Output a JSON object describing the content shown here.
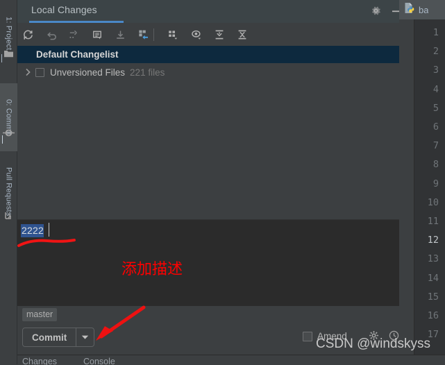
{
  "left_strip": {
    "tabs": [
      {
        "label": "1: Project",
        "icon": "project-folder-icon",
        "active": false
      },
      {
        "label": "0: Commit",
        "icon": "commit-node-icon",
        "active": true
      },
      {
        "label": "Pull Requests",
        "icon": "pull-request-icon",
        "active": false
      }
    ]
  },
  "tool_window": {
    "tab_label": "Local Changes",
    "gear_icon": "gear-icon",
    "minimize_icon": "minimize-icon",
    "accent_color": "#4a88c7"
  },
  "toolbar": {
    "buttons": [
      {
        "name": "refresh-icon",
        "title": "Refresh"
      },
      {
        "name": "rollback-icon",
        "title": "Rollback"
      },
      {
        "name": "show-diff-icon",
        "title": "Show Diff"
      },
      {
        "name": "edit-commit-message-icon",
        "title": "Edit Commit Message"
      },
      {
        "name": "update-download-icon",
        "title": "Update Project"
      },
      {
        "name": "shelve-changes-icon",
        "title": "Shelve Silently"
      },
      {
        "name": "group-by-icon",
        "title": "Group By"
      },
      {
        "name": "preview-diff-icon",
        "title": "Preview Diff"
      },
      {
        "name": "expand-all-icon",
        "title": "Expand All"
      },
      {
        "name": "collapse-all-icon",
        "title": "Collapse All"
      }
    ]
  },
  "changes_tree": {
    "changelist": {
      "label": "Default Changelist",
      "selected": true
    },
    "unversioned": {
      "expand_icon": "chevron-right-icon",
      "checkbox_checked": false,
      "label": "Unversioned Files",
      "count": "221 files"
    }
  },
  "commit_message": {
    "value": "2222",
    "selected": true
  },
  "bottom_bar": {
    "branch": "master",
    "commit_label": "Commit",
    "commit_dropdown_icon": "chevron-down-icon",
    "amend_label": "Amend",
    "amend_checked": false,
    "gear_icon": "gear-icon",
    "history_icon": "history-clock-icon"
  },
  "bottom_tabs": [
    {
      "label": "Changes"
    },
    {
      "label": "Console"
    }
  ],
  "editor": {
    "file_tab": {
      "icon": "python-file-icon",
      "name": "ba"
    },
    "line_numbers": [
      1,
      2,
      3,
      4,
      5,
      6,
      7,
      8,
      9,
      10,
      11,
      12,
      13,
      14,
      15,
      16,
      17
    ],
    "current_line": 12
  },
  "annotations": {
    "note_text": "添加描述",
    "note_color": "#ff0000",
    "underline_color": "#ff0000",
    "arrow_color": "#ee1111"
  },
  "watermark": {
    "text": "CSDN @windskyss"
  }
}
